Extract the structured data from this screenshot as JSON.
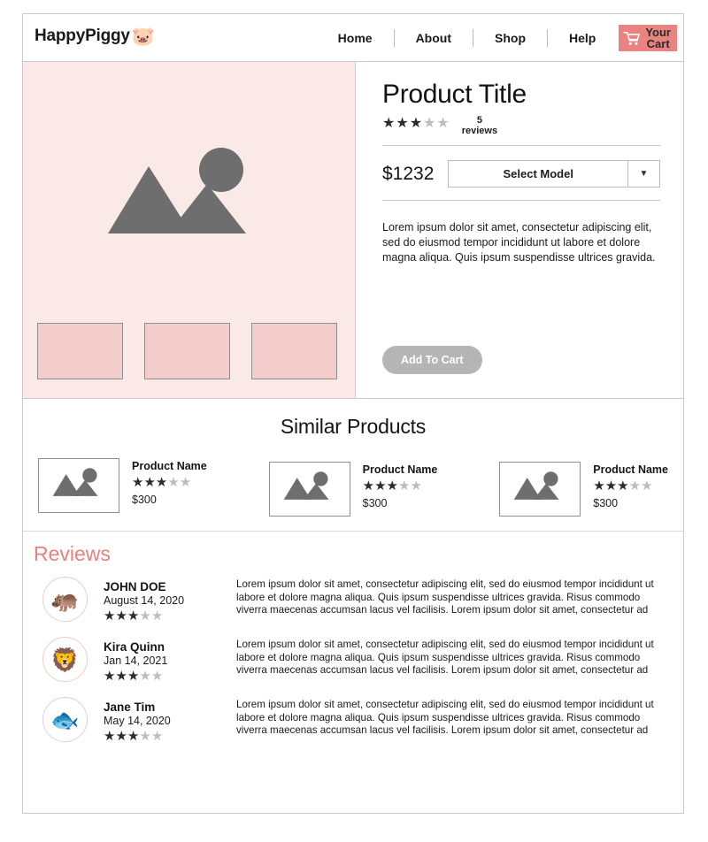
{
  "header": {
    "logo_text": "HappyPiggy",
    "logo_icon": "pig-face-icon",
    "logo_glyph": "🐷",
    "nav": [
      {
        "label": "Home"
      },
      {
        "label": "About"
      },
      {
        "label": "Shop"
      },
      {
        "label": "Help"
      }
    ],
    "cart": {
      "label_line1": "Your",
      "label_line2": "Cart",
      "icon": "shopping-cart-icon",
      "background": "#e8837f"
    }
  },
  "product": {
    "gallery": {
      "background": "#fbe9e7",
      "placeholder_icon": "image-placeholder-icon",
      "thumbnails": [
        {
          "name": "thumbnail-1"
        },
        {
          "name": "thumbnail-2"
        },
        {
          "name": "thumbnail-3"
        }
      ]
    },
    "title": "Product Title",
    "rating": {
      "filled": 3,
      "total": 5
    },
    "review_count_number": "5",
    "review_count_label": "reviews",
    "price": "$1232",
    "model_select": {
      "value": "Select Model",
      "arrow_icon": "chevron-down-icon"
    },
    "description": "Lorem ipsum dolor sit amet, consectetur adipiscing elit, sed do eiusmod tempor incididunt ut labore et dolore magna aliqua. Quis ipsum suspendisse ultrices gravida.",
    "add_to_cart_label": "Add To Cart"
  },
  "similar": {
    "title": "Similar Products",
    "items": [
      {
        "name": "Product Name",
        "rating": 3,
        "price": "$300"
      },
      {
        "name": "Product Name",
        "rating": 3,
        "price": "$300"
      },
      {
        "name": "Product Name",
        "rating": 3,
        "price": "$300"
      }
    ]
  },
  "reviews": {
    "title": "Reviews",
    "items": [
      {
        "avatar_icon": "hippo-avatar-icon",
        "avatar_glyph": "🦛",
        "name": "JOHN DOE",
        "date": "August 14, 2020",
        "rating": 3,
        "body": "Lorem ipsum dolor sit amet, consectetur adipiscing elit, sed do eiusmod tempor incididunt ut labore et dolore magna aliqua. Quis ipsum suspendisse ultrices gravida. Risus commodo viverra maecenas accumsan lacus vel facilisis. Lorem ipsum dolor sit amet, consectetur ad"
      },
      {
        "avatar_icon": "lion-avatar-icon",
        "avatar_glyph": "🦁",
        "name": "Kira Quinn",
        "date": "Jan 14, 2021",
        "rating": 3,
        "body": "Lorem ipsum dolor sit amet, consectetur adipiscing elit, sed do eiusmod tempor incididunt ut labore et dolore magna aliqua. Quis ipsum suspendisse ultrices gravida. Risus commodo viverra maecenas accumsan lacus vel facilisis. Lorem ipsum dolor sit amet, consectetur ad"
      },
      {
        "avatar_icon": "fish-avatar-icon",
        "avatar_glyph": "🐟",
        "name": "Jane Tim",
        "date": "May 14, 2020",
        "rating": 3,
        "body": "Lorem ipsum dolor sit amet, consectetur adipiscing elit, sed do eiusmod tempor incididunt ut labore et dolore magna aliqua. Quis ipsum suspendisse ultrices gravida. Risus commodo viverra maecenas accumsan lacus vel facilisis. Lorem ipsum dolor sit amet, consectetur ad"
      }
    ]
  },
  "colors": {
    "accent": "#e8827f",
    "gallery_bg": "#fbe9e7",
    "thumb_bg": "#f3cdcb",
    "placeholder_gray": "#6e6e6e",
    "star_on": "#2c2c2c",
    "star_off": "#bdbdbd"
  }
}
